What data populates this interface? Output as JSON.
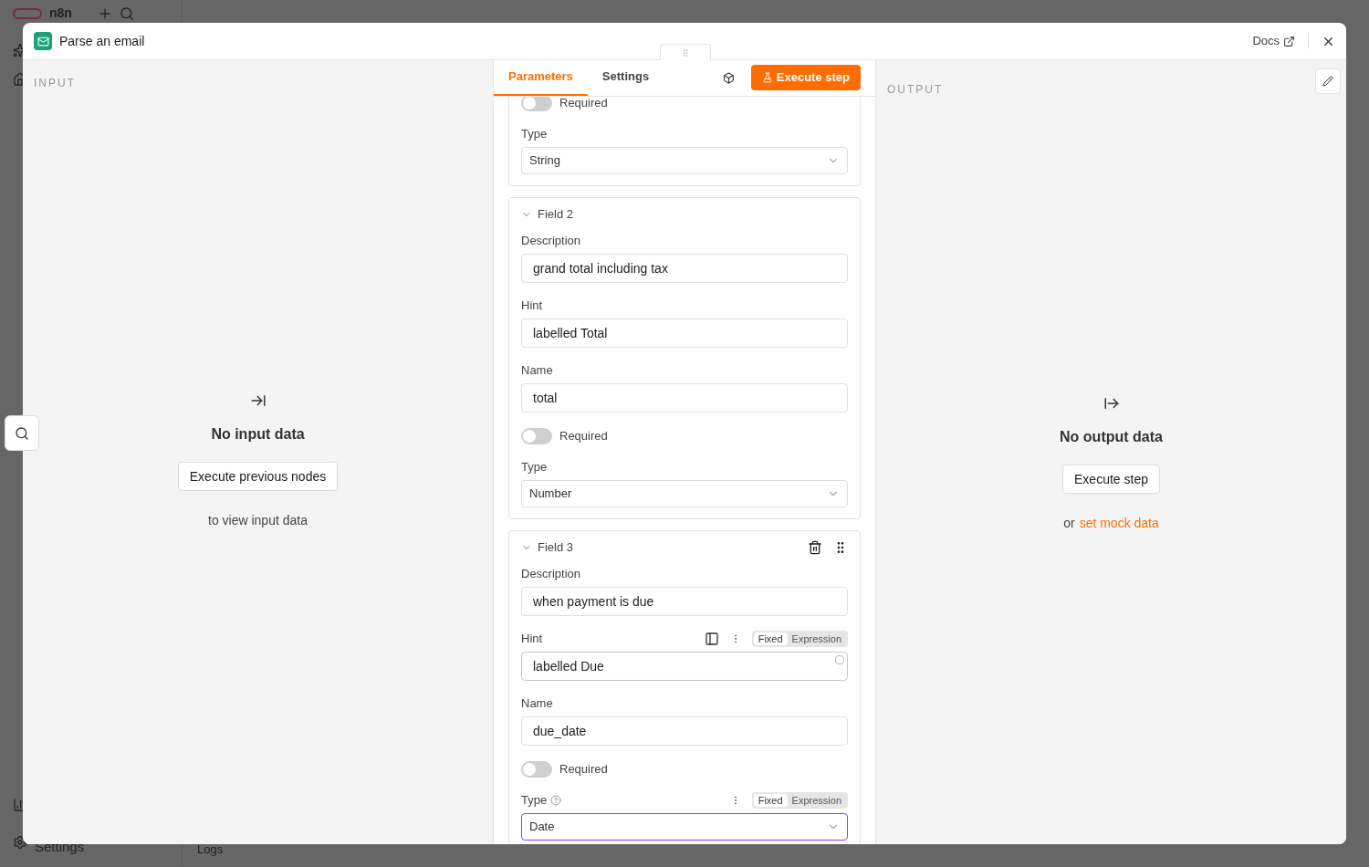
{
  "background": {
    "logo": "n8n",
    "sidebar_footer": "Settings",
    "logs_label": "Logs"
  },
  "modal": {
    "title": "Parse an email",
    "docs_link": "Docs"
  },
  "input_panel": {
    "heading": "INPUT",
    "message": "No input data",
    "button": "Execute previous nodes",
    "note": "to view input data"
  },
  "node_panel": {
    "tabs": [
      {
        "label": "Parameters",
        "selected": true
      },
      {
        "label": "Settings",
        "selected": false
      }
    ],
    "execute_button": "Execute step",
    "fields": [
      {
        "rows": [
          {
            "kind": "toggle",
            "label": "Required",
            "on": false
          },
          {
            "kind": "select",
            "label": "Type",
            "value": "String",
            "focused": false
          }
        ]
      },
      {
        "title": "Field 2",
        "expanded": true,
        "show_actions": false,
        "rows": [
          {
            "kind": "text",
            "label": "Description",
            "value": "grand total including tax"
          },
          {
            "kind": "text",
            "label": "Hint",
            "value": "labelled Total"
          },
          {
            "kind": "text",
            "label": "Name",
            "value": "total"
          },
          {
            "kind": "toggle",
            "label": "Required",
            "on": false
          },
          {
            "kind": "select",
            "label": "Type",
            "value": "Number",
            "focused": false
          }
        ]
      },
      {
        "title": "Field 3",
        "expanded": true,
        "show_actions": true,
        "rows": [
          {
            "kind": "text",
            "label": "Description",
            "value": "when payment is due"
          },
          {
            "kind": "text",
            "label": "Hint",
            "value": "labelled Due",
            "mode_options": [
              {
                "label": "Fixed",
                "selected": true
              },
              {
                "label": "Expression",
                "selected": false
              }
            ]
          },
          {
            "kind": "text",
            "label": "Name",
            "value": "due_date"
          },
          {
            "kind": "toggle",
            "label": "Required",
            "on": false
          },
          {
            "kind": "select",
            "label": "Type",
            "value": "Date",
            "focused": true,
            "help": true,
            "mode_options": [
              {
                "label": "Fixed",
                "selected": true
              },
              {
                "label": "Expression",
                "selected": false
              }
            ]
          }
        ]
      }
    ]
  },
  "output_panel": {
    "heading": "OUTPUT",
    "message": "No output data",
    "button": "Execute step",
    "note_prefix": "or",
    "note_link": "set mock data"
  }
}
